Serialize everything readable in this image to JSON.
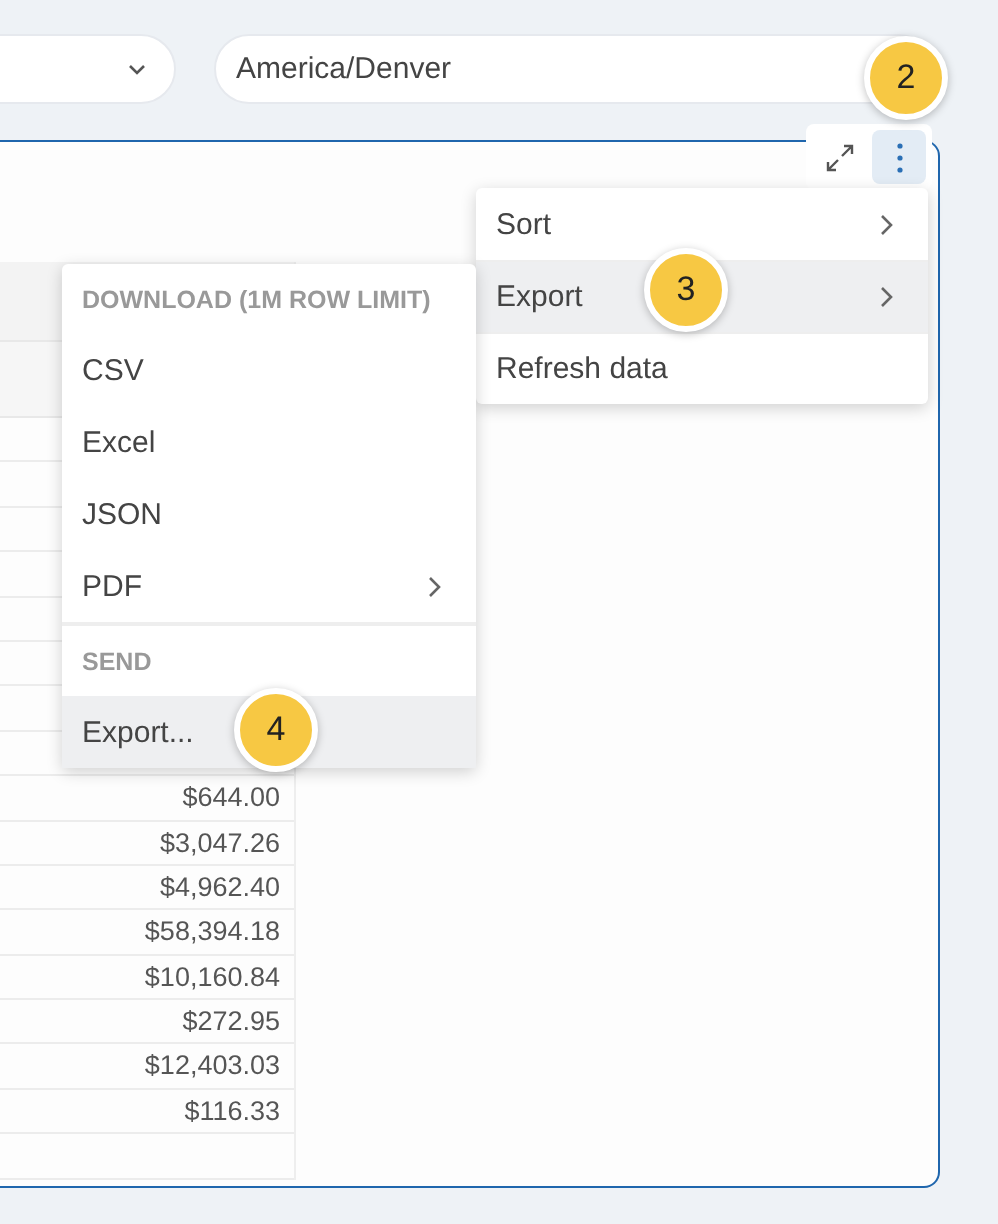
{
  "timezone_select": {
    "value": "America/Denver"
  },
  "toolbar": {
    "expand_button": {
      "selected": false
    },
    "more_button": {
      "selected": true
    }
  },
  "table": {
    "rows": [
      {
        "amount": "$644.00"
      },
      {
        "amount": "$3,047.26"
      },
      {
        "amount": "$4,962.40"
      },
      {
        "amount": "$58,394.18"
      },
      {
        "amount": "$10,160.84"
      },
      {
        "amount": "$272.95"
      },
      {
        "amount": "$12,403.03"
      },
      {
        "amount": "$116.33"
      }
    ]
  },
  "menu": {
    "items": [
      {
        "label": "Sort",
        "submenu": true,
        "highlighted": false
      },
      {
        "label": "Export",
        "submenu": true,
        "highlighted": true
      },
      {
        "label": "Refresh data",
        "submenu": false,
        "highlighted": false
      }
    ]
  },
  "export_menu": {
    "sections": [
      {
        "heading": "DOWNLOAD (1M ROW LIMIT)",
        "items": [
          {
            "label": "CSV",
            "submenu": false,
            "highlighted": false
          },
          {
            "label": "Excel",
            "submenu": false,
            "highlighted": false
          },
          {
            "label": "JSON",
            "submenu": false,
            "highlighted": false
          },
          {
            "label": "PDF",
            "submenu": true,
            "highlighted": false
          }
        ]
      },
      {
        "heading": "SEND",
        "items": [
          {
            "label": "Export...",
            "submenu": false,
            "highlighted": true
          }
        ]
      }
    ]
  },
  "callouts": [
    {
      "label": "2"
    },
    {
      "label": "3"
    },
    {
      "label": "4"
    }
  ]
}
